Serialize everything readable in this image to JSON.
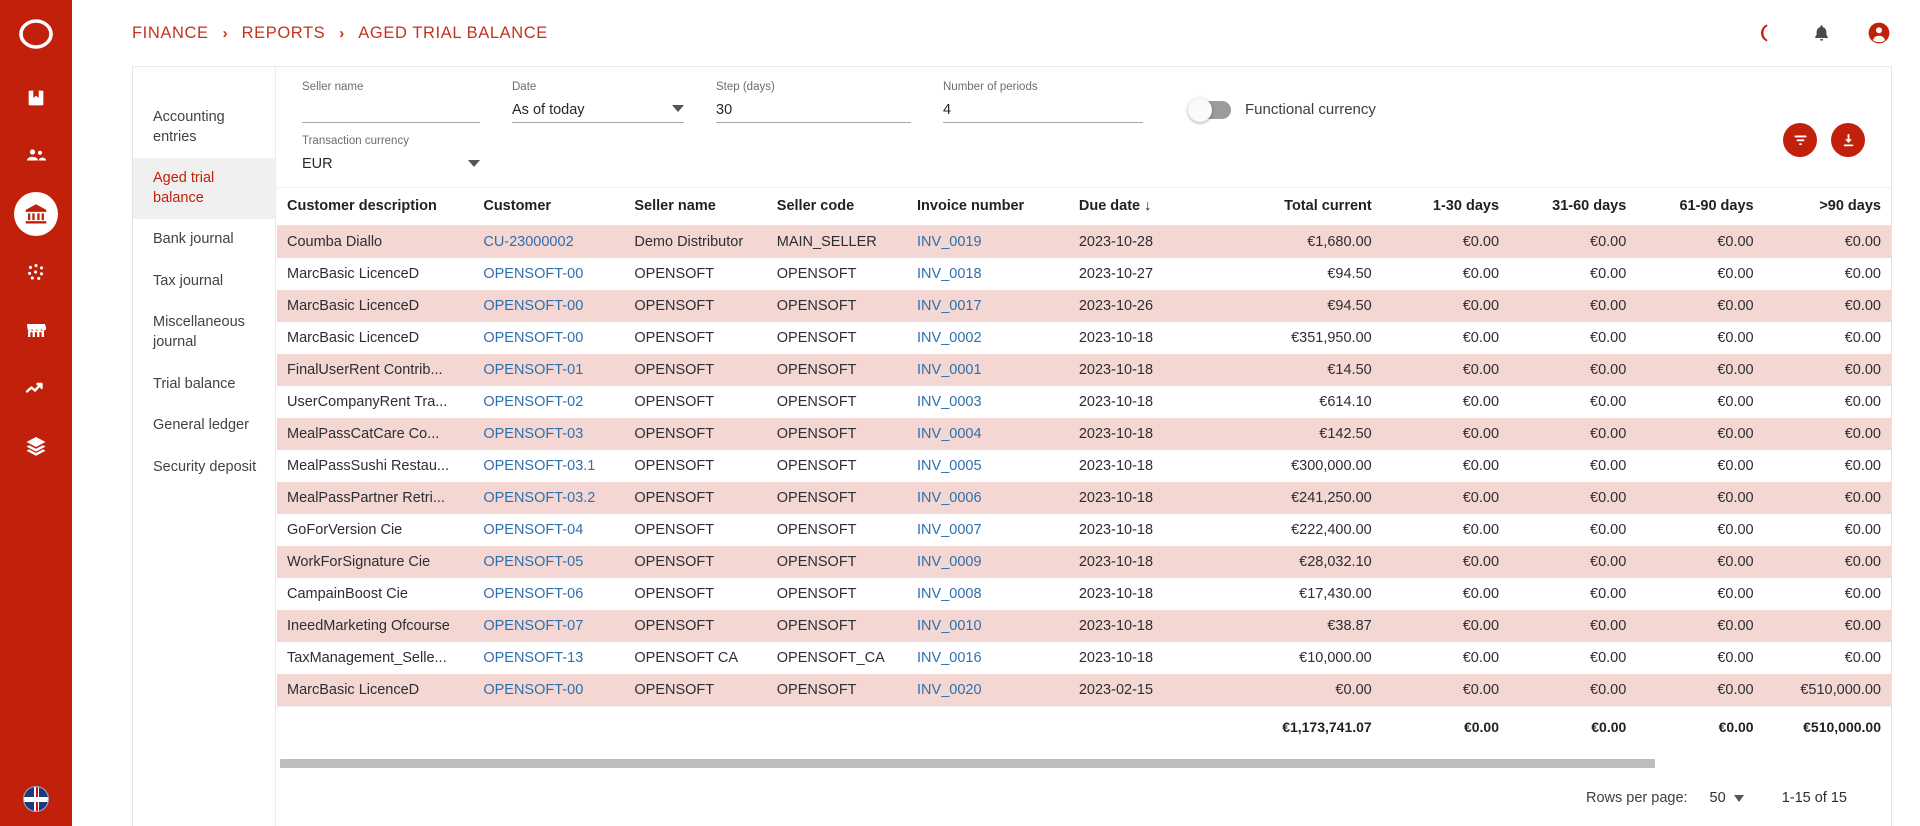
{
  "rail": {
    "logo_icon": "sage-logo-icon",
    "icons": [
      {
        "name": "book-icon",
        "active": false
      },
      {
        "name": "people-icon",
        "active": false
      },
      {
        "name": "bank-icon",
        "active": true
      },
      {
        "name": "dots-scatter-icon",
        "active": false
      },
      {
        "name": "storefront-icon",
        "active": false
      },
      {
        "name": "trending-up-icon",
        "active": false
      },
      {
        "name": "layers-icon",
        "active": false
      }
    ],
    "bottom_icon": "uk-flag-icon"
  },
  "topbar": {
    "breadcrumbs": [
      {
        "label": "FINANCE"
      },
      {
        "label": "REPORTS"
      },
      {
        "label": "AGED TRIAL BALANCE"
      }
    ],
    "separator": "›",
    "actions": [
      {
        "name": "dark-mode-icon",
        "label": "Dark mode"
      },
      {
        "name": "notifications-bell-icon",
        "label": "Notifications"
      },
      {
        "name": "account-avatar-icon",
        "label": "Account"
      }
    ]
  },
  "submenu": {
    "items": [
      {
        "label": "Accounting entries",
        "active": false
      },
      {
        "label": "Aged trial balance",
        "active": true
      },
      {
        "label": "Bank journal",
        "active": false
      },
      {
        "label": "Tax journal",
        "active": false
      },
      {
        "label": "Miscellaneous journal",
        "active": false
      },
      {
        "label": "Trial balance",
        "active": false
      },
      {
        "label": "General ledger",
        "active": false
      },
      {
        "label": "Security deposit",
        "active": false
      }
    ]
  },
  "filters": {
    "seller_name": {
      "label": "Seller name",
      "value": "",
      "placeholder": ""
    },
    "date": {
      "label": "Date",
      "value": "As of today"
    },
    "step_days": {
      "label": "Step (days)",
      "value": "30"
    },
    "number_of_periods": {
      "label": "Number of periods",
      "value": "4"
    },
    "functional_currency": {
      "label": "Functional currency",
      "on": false
    },
    "transaction_currency": {
      "label": "Transaction currency",
      "value": "EUR"
    },
    "actions": [
      {
        "name": "filter-button",
        "icon": "filter-funnel-icon"
      },
      {
        "name": "download-button",
        "icon": "download-arrow-icon"
      }
    ]
  },
  "table": {
    "columns": [
      {
        "key": "customer_description",
        "label": "Customer description",
        "align": "left"
      },
      {
        "key": "customer",
        "label": "Customer",
        "align": "left"
      },
      {
        "key": "seller_name",
        "label": "Seller name",
        "align": "left"
      },
      {
        "key": "seller_code",
        "label": "Seller code",
        "align": "left"
      },
      {
        "key": "invoice_number",
        "label": "Invoice number",
        "align": "left"
      },
      {
        "key": "due_date",
        "label": "Due date ↓",
        "align": "left"
      },
      {
        "key": "total_current",
        "label": "Total current",
        "align": "right"
      },
      {
        "key": "d1_30",
        "label": "1-30 days",
        "align": "right"
      },
      {
        "key": "d31_60",
        "label": "31-60 days",
        "align": "right"
      },
      {
        "key": "d61_90",
        "label": "61-90 days",
        "align": "right"
      },
      {
        "key": "d90plus",
        "label": ">90 days",
        "align": "right"
      }
    ],
    "rows": [
      [
        "Coumba Diallo",
        "CU-23000002",
        "Demo Distributor",
        "MAIN_SELLER",
        "INV_0019",
        "2023-10-28",
        "€1,680.00",
        "€0.00",
        "€0.00",
        "€0.00",
        "€0.00"
      ],
      [
        "MarcBasic LicenceD",
        "OPENSOFT-00",
        "OPENSOFT",
        "OPENSOFT",
        "INV_0018",
        "2023-10-27",
        "€94.50",
        "€0.00",
        "€0.00",
        "€0.00",
        "€0.00"
      ],
      [
        "MarcBasic LicenceD",
        "OPENSOFT-00",
        "OPENSOFT",
        "OPENSOFT",
        "INV_0017",
        "2023-10-26",
        "€94.50",
        "€0.00",
        "€0.00",
        "€0.00",
        "€0.00"
      ],
      [
        "MarcBasic LicenceD",
        "OPENSOFT-00",
        "OPENSOFT",
        "OPENSOFT",
        "INV_0002",
        "2023-10-18",
        "€351,950.00",
        "€0.00",
        "€0.00",
        "€0.00",
        "€0.00"
      ],
      [
        "FinalUserRent Contrib...",
        "OPENSOFT-01",
        "OPENSOFT",
        "OPENSOFT",
        "INV_0001",
        "2023-10-18",
        "€14.50",
        "€0.00",
        "€0.00",
        "€0.00",
        "€0.00"
      ],
      [
        "UserCompanyRent Tra...",
        "OPENSOFT-02",
        "OPENSOFT",
        "OPENSOFT",
        "INV_0003",
        "2023-10-18",
        "€614.10",
        "€0.00",
        "€0.00",
        "€0.00",
        "€0.00"
      ],
      [
        "MealPassCatCare Co...",
        "OPENSOFT-03",
        "OPENSOFT",
        "OPENSOFT",
        "INV_0004",
        "2023-10-18",
        "€142.50",
        "€0.00",
        "€0.00",
        "€0.00",
        "€0.00"
      ],
      [
        "MealPassSushi Restau...",
        "OPENSOFT-03.1",
        "OPENSOFT",
        "OPENSOFT",
        "INV_0005",
        "2023-10-18",
        "€300,000.00",
        "€0.00",
        "€0.00",
        "€0.00",
        "€0.00"
      ],
      [
        "MealPassPartner Retri...",
        "OPENSOFT-03.2",
        "OPENSOFT",
        "OPENSOFT",
        "INV_0006",
        "2023-10-18",
        "€241,250.00",
        "€0.00",
        "€0.00",
        "€0.00",
        "€0.00"
      ],
      [
        "GoForVersion Cie",
        "OPENSOFT-04",
        "OPENSOFT",
        "OPENSOFT",
        "INV_0007",
        "2023-10-18",
        "€222,400.00",
        "€0.00",
        "€0.00",
        "€0.00",
        "€0.00"
      ],
      [
        "WorkForSignature Cie",
        "OPENSOFT-05",
        "OPENSOFT",
        "OPENSOFT",
        "INV_0009",
        "2023-10-18",
        "€28,032.10",
        "€0.00",
        "€0.00",
        "€0.00",
        "€0.00"
      ],
      [
        "CampainBoost Cie",
        "OPENSOFT-06",
        "OPENSOFT",
        "OPENSOFT",
        "INV_0008",
        "2023-10-18",
        "€17,430.00",
        "€0.00",
        "€0.00",
        "€0.00",
        "€0.00"
      ],
      [
        "IneedMarketing Ofcourse",
        "OPENSOFT-07",
        "OPENSOFT",
        "OPENSOFT",
        "INV_0010",
        "2023-10-18",
        "€38.87",
        "€0.00",
        "€0.00",
        "€0.00",
        "€0.00"
      ],
      [
        "TaxManagement_Selle...",
        "OPENSOFT-13",
        "OPENSOFT CA",
        "OPENSOFT_CA",
        "INV_0016",
        "2023-10-18",
        "€10,000.00",
        "€0.00",
        "€0.00",
        "€0.00",
        "€0.00"
      ],
      [
        "MarcBasic LicenceD",
        "OPENSOFT-00",
        "OPENSOFT",
        "OPENSOFT",
        "INV_0020",
        "2023-02-15",
        "€0.00",
        "€0.00",
        "€0.00",
        "€0.00",
        "€510,000.00"
      ]
    ],
    "totals": {
      "total_current": "€1,173,741.07",
      "d1_30": "€0.00",
      "d31_60": "€0.00",
      "d61_90": "€0.00",
      "d90plus": "€510,000.00"
    }
  },
  "paginator": {
    "rows_per_page_label": "Rows per page:",
    "rows_per_page_value": "50",
    "range": "1-15 of 15"
  },
  "colors": {
    "brand_red": "#c1200b",
    "breadcrumb_red": "#c5321f",
    "row_stripe": "#f4d7d2",
    "link_blue": "#2f6fad"
  }
}
